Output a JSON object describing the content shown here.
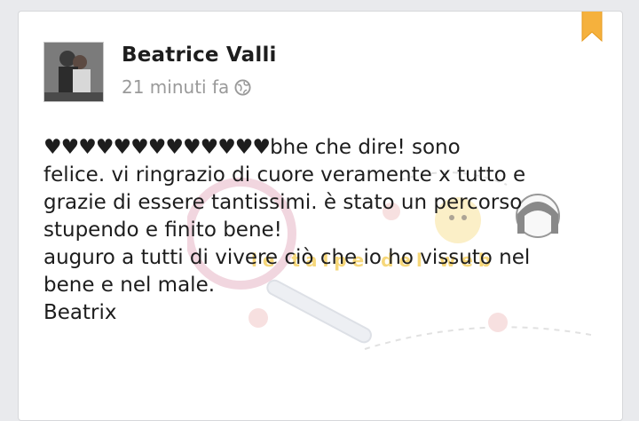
{
  "post": {
    "author": "Beatrice Valli",
    "time": "21 minuti fa",
    "hearts": "♥♥♥♥♥♥♥♥♥♥♥♥♥",
    "text": "bhe che dire! sono\nfelice. vi ringrazio di cuore veramente x tutto e\ngrazie di essere tantissimi. è stato un percorso\nstupendo e finito bene!\nauguro a tutti di vivere ciò che io ho vissuto nel\nbene e nel male.\nBeatrix"
  },
  "watermark": {
    "text": "le talpe del web"
  },
  "colors": {
    "bookmark": "#f5b13d",
    "card": "#ffffff",
    "background": "#e9eaed"
  },
  "icons": {
    "privacy": "globe-icon",
    "save": "bookmark-icon"
  }
}
